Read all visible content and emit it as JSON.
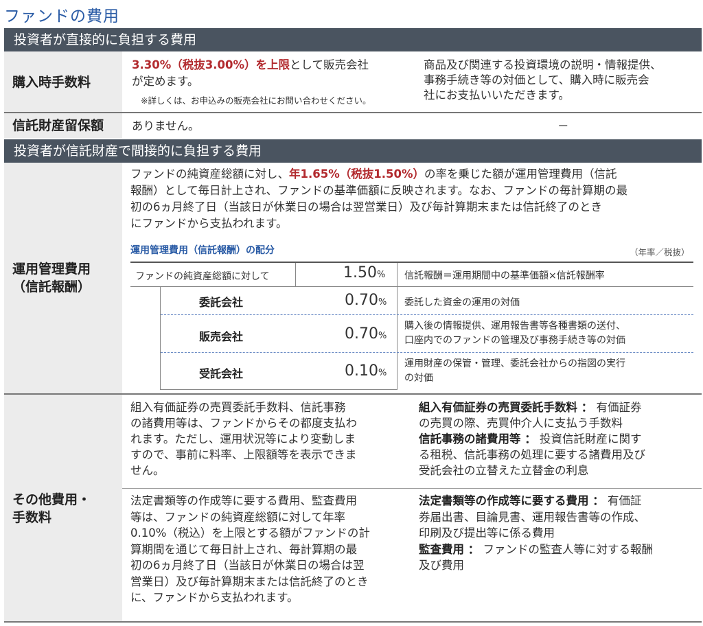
{
  "title": "ファンドの費用",
  "section1": "投資者が直接的に負担する費用",
  "purchase_fee": {
    "label": "購入時手数料",
    "rate": "3.30%（税抜3.00%）を上限",
    "text1": "として販売会社",
    "text2": "が定めます。",
    "note": "※詳しくは、お申込みの販売会社にお問い合わせください。",
    "desc": [
      "商品及び関連する投資環境の説明・情報提供、",
      "事務手続き等の対価として、購入時に販売会",
      "社にお支払いいただきます。"
    ]
  },
  "retention": {
    "label": "信託財産留保額",
    "value": "ありません。",
    "desc": "－"
  },
  "section2": "投資者が信託財産で間接的に負担する費用",
  "mgmt_fee": {
    "label": [
      "運用管理費用",
      "（信託報酬）"
    ],
    "line1_a": "ファンドの純資産総額に対し、",
    "line1_rate": "年1.65%（税抜1.50%）",
    "line1_b": "の率を乗じた額が運用管理費用（信託",
    "lines": [
      "報酬）として毎日計上され、ファンドの基準価額に反映されます。なお、ファンドの毎計算期の最",
      "初の6ヵ月終了日（当該日が休業日の場合は翌営業日）及び毎計算期末または信託終了のとき",
      "にファンドから支払われます。"
    ],
    "table_title": "運用管理費用（信託報酬）の配分",
    "table_unit": "（年率／税抜）",
    "total": {
      "label": "ファンドの純資産総額に対して",
      "value": "1.50",
      "pct": "%",
      "desc": "信託報酬＝運用期間中の基準価額×信託報酬率"
    },
    "rows": [
      {
        "label": "委託会社",
        "value": "0.70",
        "pct": "%",
        "desc": [
          "委託した資金の運用の対価"
        ]
      },
      {
        "label": "販売会社",
        "value": "0.70",
        "pct": "%",
        "desc": [
          "購入後の情報提供、運用報告書等各種書類の送付、",
          "口座内でのファンドの管理及び事務手続き等の対価"
        ]
      },
      {
        "label": "受託会社",
        "value": "0.10",
        "pct": "%",
        "desc": [
          "運用財産の保管・管理、委託会社からの指図の実行",
          "の対価"
        ]
      }
    ]
  },
  "other_fee": {
    "label": [
      "その他費用・",
      "手数料"
    ],
    "left1": [
      "組入有価証券の売買委託手数料、信託事務",
      "の諸費用等は、ファンドからその都度支払わ",
      "れます。ただし、運用状況等により変動しま",
      "すので、事前に料率、上限額等を表示できま",
      "せん。"
    ],
    "right1": [
      {
        "bold": "組入有価証券の売買委託手数料 ：",
        "text": " 有価証券"
      },
      {
        "bold": "",
        "text": "の売買の際、売買仲介人に支払う手数料"
      },
      {
        "bold": "信託事務の諸費用等 ：",
        "text": " 投資信託財産に関す"
      },
      {
        "bold": "",
        "text": "る租税、信託事務の処理に要する諸費用及び"
      },
      {
        "bold": "",
        "text": "受託会社の立替えた立替金の利息"
      }
    ],
    "left2": [
      "法定書類等の作成等に要する費用、監査費用",
      "等は、ファンドの純資産総額に対して年率",
      "0.10%（税込）を上限とする額がファンドの計",
      "算期間を通じて毎日計上され、毎計算期の最",
      "初の6ヵ月終了日（当該日が休業日の場合は翌",
      "営業日）及び毎計算期末または信託終了のとき",
      "に、ファンドから支払われます。"
    ],
    "right2": [
      {
        "bold": "法定書類等の作成等に要する費用 ：",
        "text": " 有価証"
      },
      {
        "bold": "",
        "text": "券届出書、目論見書、運用報告書等の作成、"
      },
      {
        "bold": "",
        "text": "印刷及び提出等に係る費用"
      },
      {
        "bold": "監査費用 ：",
        "text": " ファンドの監査人等に対する報酬"
      },
      {
        "bold": "",
        "text": "及び費用"
      }
    ]
  }
}
